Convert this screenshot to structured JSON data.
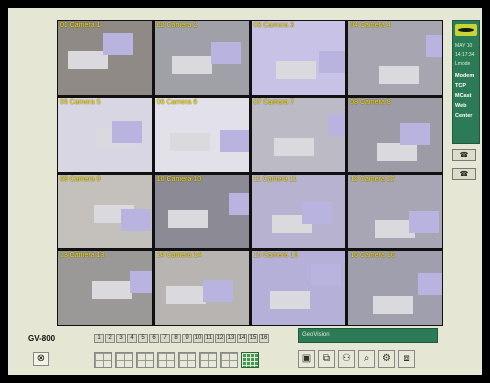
{
  "model_label": "GV-800",
  "cameras": [
    {
      "label": "01 Camera 1",
      "bg": "#8f8a86"
    },
    {
      "label": "02 Camera 2",
      "bg": "#9fa0a8"
    },
    {
      "label": "03 Camera 3",
      "bg": "#c8c2e6"
    },
    {
      "label": "04 Camera 4",
      "bg": "#a7a6b0"
    },
    {
      "label": "05 Camera 5",
      "bg": "#d9d6e4"
    },
    {
      "label": "06 Camera 6",
      "bg": "#e2e1ea"
    },
    {
      "label": "07 Camera 7",
      "bg": "#bcbac4"
    },
    {
      "label": "08 Camera 8",
      "bg": "#9c9ba6"
    },
    {
      "label": "09 Camera 9",
      "bg": "#c4c0bc"
    },
    {
      "label": "10 Camera 10",
      "bg": "#8c8a94"
    },
    {
      "label": "11 Camera 11",
      "bg": "#b6b2d0"
    },
    {
      "label": "12 Camera 12",
      "bg": "#a8a6b4"
    },
    {
      "label": "13 Camera 13",
      "bg": "#9a9998"
    },
    {
      "label": "14 Camera 14",
      "bg": "#b8b4b2"
    },
    {
      "label": "15 Camera 15",
      "bg": "#b4b0d8"
    },
    {
      "label": "16 Camera 16",
      "bg": "#a09fae"
    }
  ],
  "side_panel": {
    "date": "MAY 10",
    "time": "14:17:34",
    "mode": "Lmode",
    "items": [
      "Modem",
      "TCP",
      "MCast",
      "Web",
      "Center"
    ]
  },
  "side_buttons": [
    "☎",
    "☎"
  ],
  "channel_numbers": [
    "1",
    "2",
    "3",
    "4",
    "5",
    "6",
    "7",
    "8",
    "9",
    "10",
    "11",
    "12",
    "13",
    "14",
    "15",
    "16"
  ],
  "status_text": "GeoVision",
  "colors": {
    "panel_green": "#2d7a57",
    "label_yellow": "#ffe600",
    "frame": "#e6e6d4"
  }
}
